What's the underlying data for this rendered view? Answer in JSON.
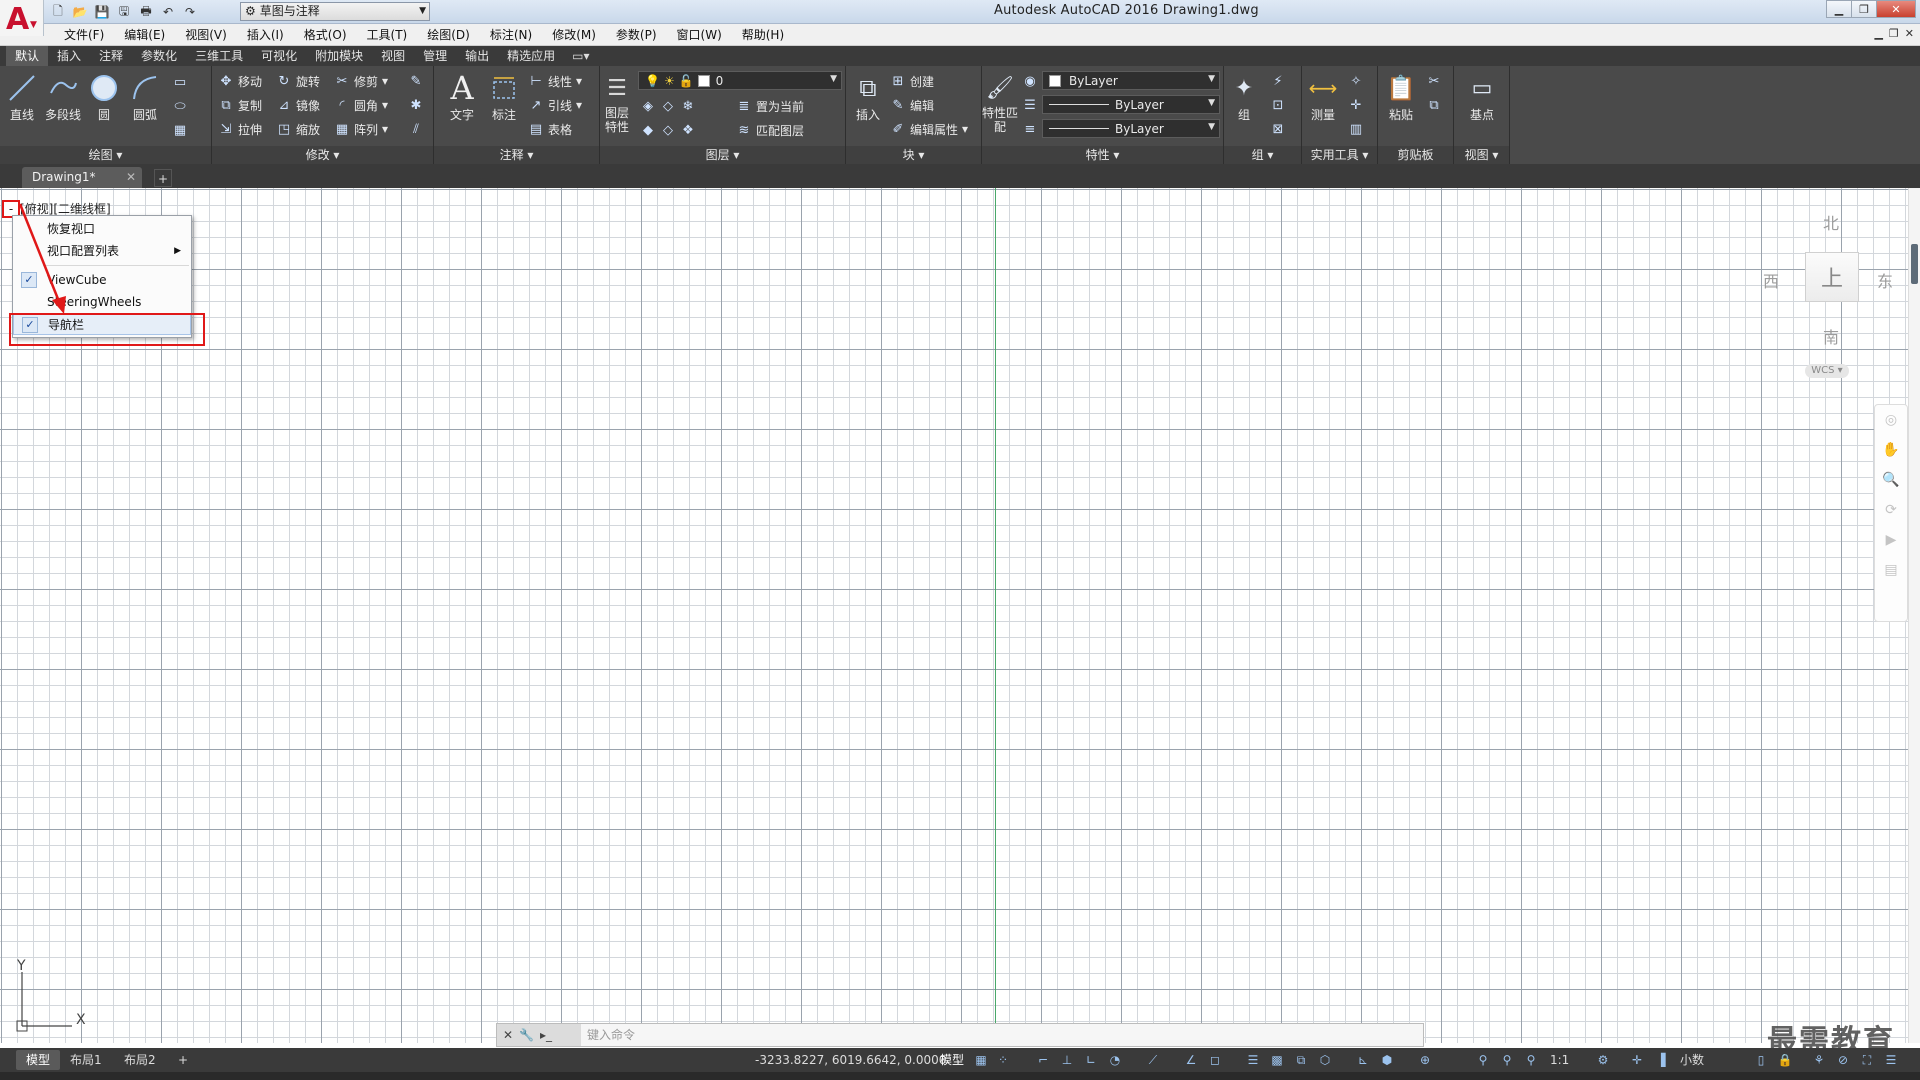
{
  "titlebar": {
    "workspace": "草图与注释",
    "title": "Autodesk AutoCAD 2016    Drawing1.dwg"
  },
  "menubar": {
    "items": [
      "文件(F)",
      "编辑(E)",
      "视图(V)",
      "插入(I)",
      "格式(O)",
      "工具(T)",
      "绘图(D)",
      "标注(N)",
      "修改(M)",
      "参数(P)",
      "窗口(W)",
      "帮助(H)"
    ]
  },
  "ribbon_tabs": [
    "默认",
    "插入",
    "注释",
    "参数化",
    "三维工具",
    "可视化",
    "附加模块",
    "视图",
    "管理",
    "输出",
    "精选应用"
  ],
  "ribbon": {
    "draw": {
      "line": "直线",
      "polyline": "多段线",
      "circle": "圆",
      "arc": "圆弧",
      "footer": "绘图"
    },
    "modify": {
      "move": "移动",
      "rotate": "旋转",
      "trim": "修剪",
      "copy": "复制",
      "mirror": "镜像",
      "fillet": "圆角",
      "stretch": "拉伸",
      "scale": "缩放",
      "array": "阵列",
      "footer": "修改"
    },
    "annotation": {
      "text": "文字",
      "dimension": "标注",
      "linear": "线性",
      "leader": "引线",
      "table": "表格",
      "footer": "注释"
    },
    "layers": {
      "layer_props": "图层特性",
      "layer_value": "0",
      "set_current": "置为当前",
      "match_layer": "匹配图层",
      "footer": "图层"
    },
    "block": {
      "insert": "插入",
      "create": "创建",
      "edit": "编辑",
      "edit_attr": "编辑属性",
      "footer": "块"
    },
    "properties": {
      "match": "特性匹配",
      "color": "ByLayer",
      "linetype": "ByLayer",
      "lineweight": "ByLayer",
      "footer": "特性"
    },
    "groups": {
      "group": "组",
      "footer": "组"
    },
    "utilities": {
      "measure": "测量",
      "footer": "实用工具"
    },
    "clipboard": {
      "paste": "粘贴",
      "footer": "剪贴板"
    },
    "view": {
      "base": "基点",
      "footer": "视图"
    }
  },
  "file_tabs": {
    "active": "Drawing1*"
  },
  "viewport": {
    "label": "[俯视][二维线框]",
    "minus": "-"
  },
  "context_menu": {
    "items": [
      {
        "label": "恢复视口",
        "checked": false
      },
      {
        "label": "视口配置列表",
        "submenu": true
      },
      {
        "label": "ViewCube",
        "checked": true
      },
      {
        "label": "SteeringWheels",
        "checked": false
      },
      {
        "label": "导航栏",
        "checked": true
      }
    ]
  },
  "viewcube": {
    "north": "北",
    "south": "南",
    "east": "东",
    "west": "西",
    "face": "上",
    "wcs": "WCS"
  },
  "ucs": {
    "x": "X",
    "y": "Y"
  },
  "command_line": {
    "placeholder": "键入命令"
  },
  "layout_tabs": [
    "模型",
    "布局1",
    "布局2"
  ],
  "statusbar": {
    "coords": "-3233.8227, 6019.6642, 0.0000",
    "model": "模型",
    "scale": "1:1",
    "units": "小数"
  },
  "watermark": "最需教育"
}
